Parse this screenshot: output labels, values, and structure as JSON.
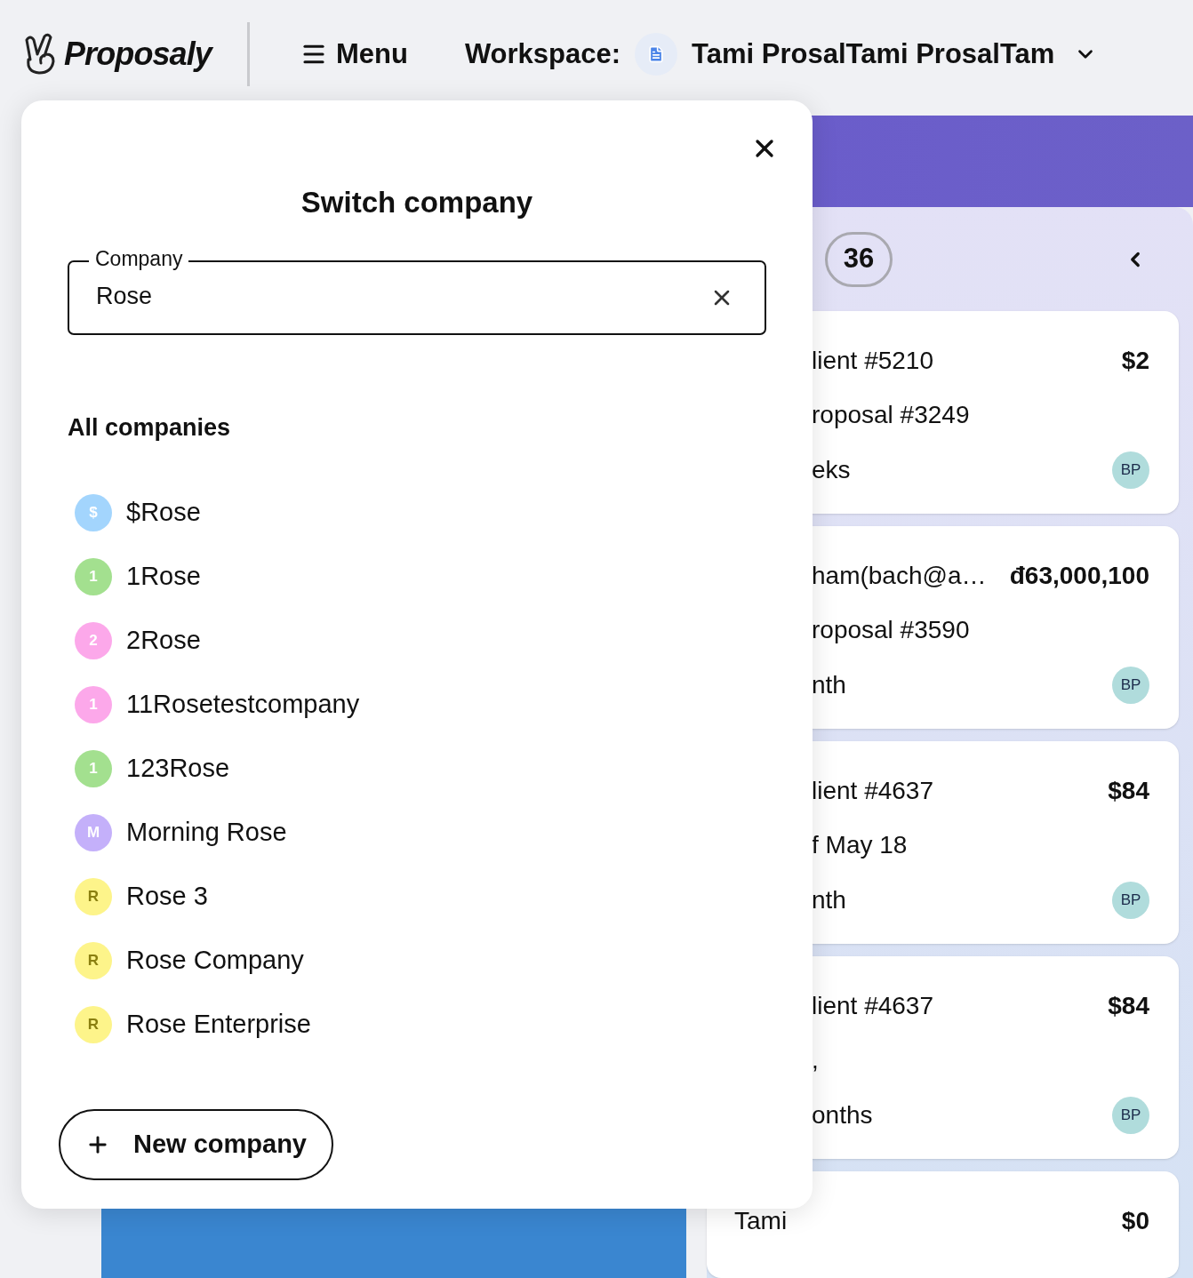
{
  "header": {
    "logo": "Proposaly",
    "menu": "Menu",
    "workspace_label": "Workspace:",
    "workspace_name": "Tami ProsalTami ProsalTam"
  },
  "background": {
    "count": "36",
    "cards": [
      {
        "title": "lient #5210",
        "amount": "$2",
        "subtitle": "roposal #3249",
        "duration": "eks",
        "avatar": "BP"
      },
      {
        "title": "ham(bach@a…",
        "amount": "đ63,000,100",
        "subtitle": "roposal #3590",
        "duration": "nth",
        "avatar": "BP"
      },
      {
        "title": "lient #4637",
        "amount": "$84",
        "subtitle": "f May 18",
        "duration": "nth",
        "avatar": "BP"
      },
      {
        "title": "lient #4637",
        "amount": "$84",
        "subtitle": ",",
        "duration": "onths",
        "avatar": "BP"
      },
      {
        "title": "Tami",
        "amount": "$0"
      }
    ]
  },
  "modal": {
    "title": "Switch company",
    "field": {
      "label": "Company",
      "value": "Rose"
    },
    "section": "All companies",
    "companies": [
      {
        "initial": "$",
        "name": "$Rose",
        "color": "#a3d5fd"
      },
      {
        "initial": "1",
        "name": "1Rose",
        "color": "#a3e08f"
      },
      {
        "initial": "2",
        "name": "2Rose",
        "color": "#fca8ea"
      },
      {
        "initial": "1",
        "name": "11Rosetestcompany",
        "color": "#fca8ea"
      },
      {
        "initial": "1",
        "name": "123Rose",
        "color": "#a3e08f"
      },
      {
        "initial": "M",
        "name": "Morning Rose",
        "color": "#c4b0fa"
      },
      {
        "initial": "R",
        "name": "Rose 3",
        "color": "#fdf48a"
      },
      {
        "initial": "R",
        "name": "Rose Company",
        "color": "#fdf48a"
      },
      {
        "initial": "R",
        "name": "Rose Enterprise",
        "color": "#fdf48a"
      }
    ],
    "new_button": "New company"
  }
}
